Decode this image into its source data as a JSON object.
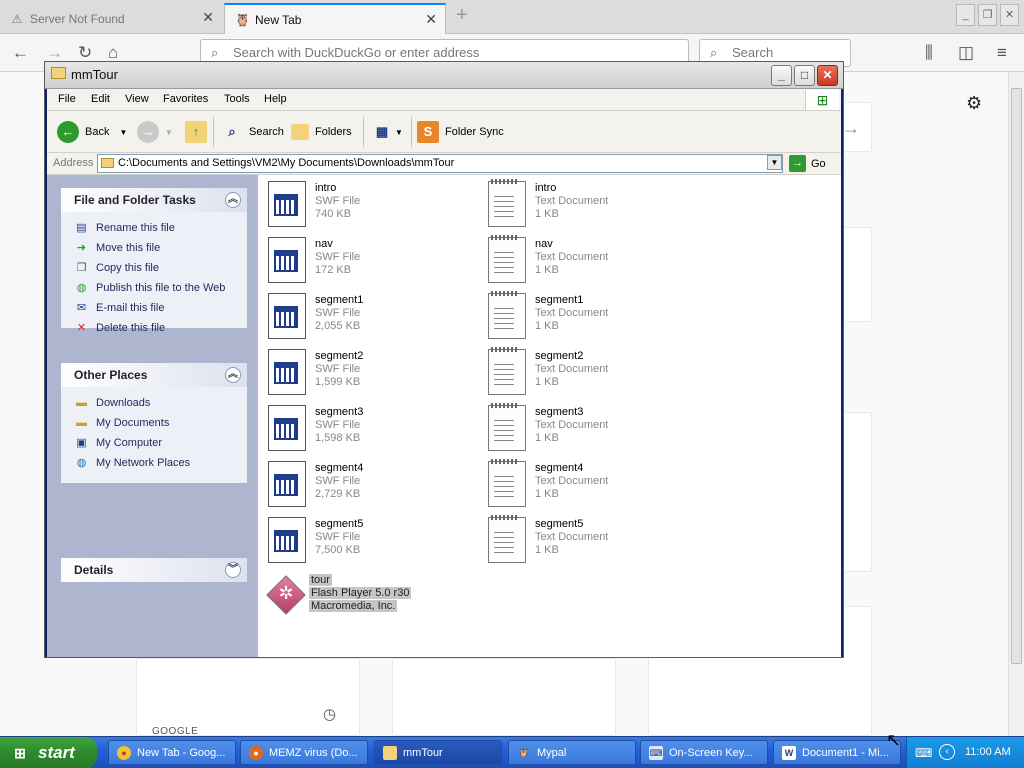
{
  "firefox": {
    "tabs": [
      {
        "label": "Server Not Found",
        "icon": "warning-icon"
      },
      {
        "label": "New Tab",
        "icon": "mypal-icon"
      }
    ],
    "url_placeholder": "Search with DuckDuckGo or enter address",
    "search_placeholder": "Search",
    "google_label": "GOOGLE"
  },
  "explorer": {
    "title": "mmTour",
    "menu": [
      "File",
      "Edit",
      "View",
      "Favorites",
      "Tools",
      "Help"
    ],
    "toolbar": {
      "back": "Back",
      "search": "Search",
      "folders": "Folders",
      "folder_sync": "Folder Sync"
    },
    "address": {
      "label": "Address",
      "path": "C:\\Documents and Settings\\VM2\\My Documents\\Downloads\\mmTour",
      "go": "Go"
    },
    "tasks": {
      "title": "File and Folder Tasks",
      "items": [
        "Rename this file",
        "Move this file",
        "Copy this file",
        "Publish this file to the Web",
        "E-mail this file",
        "Delete this file"
      ]
    },
    "other_places": {
      "title": "Other Places",
      "items": [
        "Downloads",
        "My Documents",
        "My Computer",
        "My Network Places"
      ]
    },
    "details": {
      "title": "Details"
    },
    "files": [
      {
        "name": "intro",
        "type": "SWF File",
        "size": "740 KB"
      },
      {
        "name": "intro",
        "type": "Text Document",
        "size": "1 KB"
      },
      {
        "name": "nav",
        "type": "SWF File",
        "size": "172 KB"
      },
      {
        "name": "nav",
        "type": "Text Document",
        "size": "1 KB"
      },
      {
        "name": "segment1",
        "type": "SWF File",
        "size": "2,055 KB"
      },
      {
        "name": "segment1",
        "type": "Text Document",
        "size": "1 KB"
      },
      {
        "name": "segment2",
        "type": "SWF File",
        "size": "1,599 KB"
      },
      {
        "name": "segment2",
        "type": "Text Document",
        "size": "1 KB"
      },
      {
        "name": "segment3",
        "type": "SWF File",
        "size": "1,598 KB"
      },
      {
        "name": "segment3",
        "type": "Text Document",
        "size": "1 KB"
      },
      {
        "name": "segment4",
        "type": "SWF File",
        "size": "2,729 KB"
      },
      {
        "name": "segment4",
        "type": "Text Document",
        "size": "1 KB"
      },
      {
        "name": "segment5",
        "type": "SWF File",
        "size": "7,500 KB"
      },
      {
        "name": "segment5",
        "type": "Text Document",
        "size": "1 KB"
      },
      {
        "name": "tour",
        "type": "Flash Player 5.0 r30",
        "size": "Macromedia, Inc."
      }
    ]
  },
  "taskbar": {
    "start": "start",
    "tasks": [
      {
        "label": "New Tab - Goog...",
        "icon": "chrome-icon"
      },
      {
        "label": "MEMZ virus (Do...",
        "icon": "firefox-icon"
      },
      {
        "label": "mmTour",
        "icon": "folder-icon"
      },
      {
        "label": "Mypal",
        "icon": "mypal-icon"
      },
      {
        "label": "On-Screen Key...",
        "icon": "keyboard-icon"
      },
      {
        "label": "Document1 - Mi...",
        "icon": "word-icon"
      }
    ],
    "clock": "11:00 AM"
  }
}
